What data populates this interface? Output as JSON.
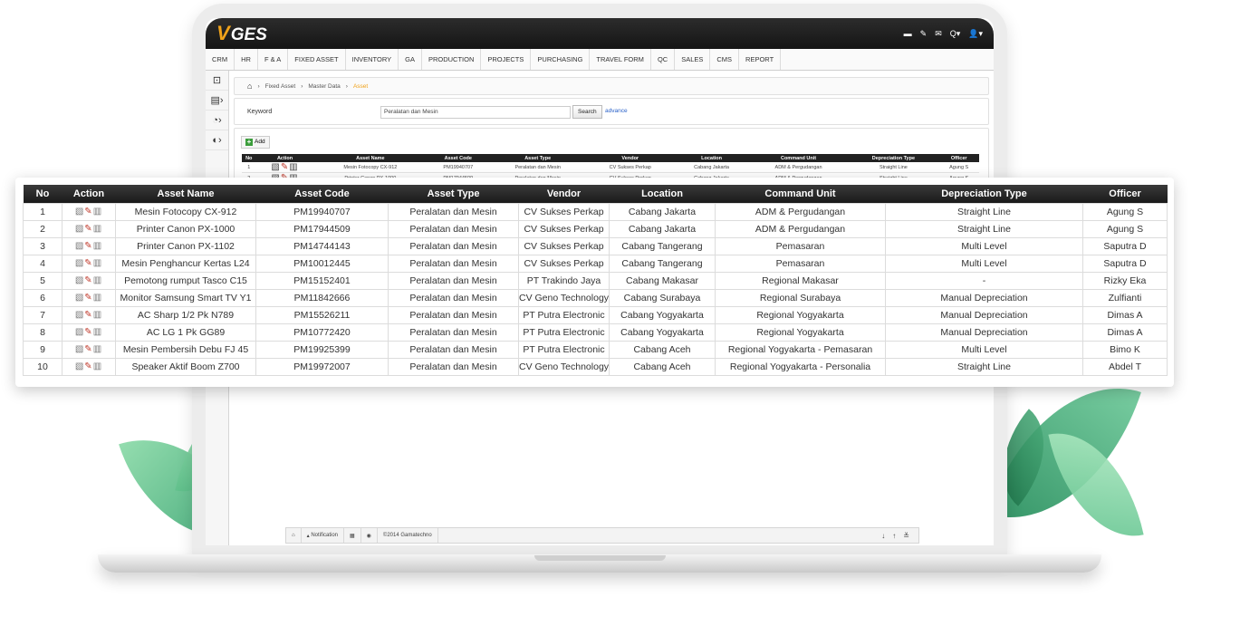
{
  "app": {
    "logo_v": "V",
    "logo_text": "GES"
  },
  "top_icons": [
    "folder-icon",
    "wrench-icon",
    "mail-icon",
    "search-icon",
    "user-icon"
  ],
  "top_icons_labels": {
    "folder": "▬",
    "wrench": "✎",
    "mail": "✉",
    "search": "Q▾",
    "user": "👤▾"
  },
  "menu": [
    "CRM",
    "HR",
    "F & A",
    "FIXED ASSET",
    "INVENTORY",
    "GA",
    "PRODUCTION",
    "PROJECTS",
    "PURCHASING",
    "TRAVEL FORM",
    "QC",
    "SALES",
    "CMS",
    "REPORT"
  ],
  "breadcrumb": {
    "home": "⌂",
    "items": [
      "Fixed Asset",
      "Master Data"
    ],
    "active": "Asset"
  },
  "search": {
    "label": "Keyword",
    "value": "Peralatan dan Mesin",
    "button": "Search",
    "advance": "advance"
  },
  "add_button": "Add",
  "table": {
    "headers": [
      "No",
      "Action",
      "Asset Name",
      "Asset Code",
      "Asset Type",
      "Vendor",
      "Location",
      "Command Unit",
      "Depreciation Type",
      "Officer"
    ],
    "rows": [
      [
        "1",
        "Mesin Fotocopy CX-912",
        "PM19940707",
        "Peralatan dan Mesin",
        "CV Sukses Perkap",
        "Cabang Jakarta",
        "ADM & Pergudangan",
        "Straight Line",
        "Agung S"
      ],
      [
        "2",
        "Printer Canon PX-1000",
        "PM17944509",
        "Peralatan dan Mesin",
        "CV Sukses Perkap",
        "Cabang Jakarta",
        "ADM & Pergudangan",
        "Straight Line",
        "Agung S"
      ],
      [
        "3",
        "Printer Canon PX-1102",
        "PM14744143",
        "Peralatan dan Mesin",
        "CV Sukses Perkap",
        "Cabang Tangerang",
        "Pemasaran",
        "Multi Level",
        "Saputra D"
      ],
      [
        "4",
        "Mesin Penghancur Kertas L24",
        "PM10012445",
        "Peralatan dan Mesin",
        "CV Sukses Perkap",
        "Cabang Tangerang",
        "Pemasaran",
        "Multi Level",
        "Saputra D"
      ],
      [
        "5",
        "Pemotong rumput Tasco C15",
        "PM15152401",
        "Peralatan dan Mesin",
        "PT Trakindo Jaya",
        "Cabang Makasar",
        "Regional Makasar",
        "-",
        "Rizky Eka"
      ],
      [
        "6",
        "Monitor Samsung Smart TV Y1",
        "PM11842666",
        "Peralatan dan Mesin",
        "CV Geno Technology",
        "Cabang Surabaya",
        "Regional Surabaya",
        "Manual Depreciation",
        "Zulfianti"
      ],
      [
        "7",
        "AC Sharp 1/2 Pk N789",
        "PM15526211",
        "Peralatan dan Mesin",
        "PT Putra Electronic",
        "Cabang Yogyakarta",
        "Regional Yogyakarta",
        "Manual Depreciation",
        "Dimas A"
      ],
      [
        "8",
        "AC LG 1 Pk GG89",
        "PM10772420",
        "Peralatan dan Mesin",
        "PT Putra Electronic",
        "Cabang Yogyakarta",
        "Regional Yogyakarta",
        "Manual Depreciation",
        "Dimas A"
      ],
      [
        "9",
        "Mesin Pembersih Debu FJ 45",
        "PM19925399",
        "Peralatan dan Mesin",
        "PT Putra Electronic",
        "Cabang Aceh",
        "Regional Yogyakarta - Pemasaran",
        "Multi Level",
        "Bimo K"
      ],
      [
        "10",
        "Speaker Aktif Boom Z700",
        "PM19972007",
        "Peralatan dan Mesin",
        "CV Geno Technology",
        "Cabang Aceh",
        "Regional Yogyakarta - Personalia",
        "Straight Line",
        "Abdel T"
      ]
    ]
  },
  "footer": {
    "notification": "Notification",
    "copyright": "©2014 Gamatechno"
  },
  "colors": {
    "accent": "#f0a21a",
    "header": "#1a1a1a",
    "link": "#2a62c9",
    "add": "#3b9d3b"
  }
}
